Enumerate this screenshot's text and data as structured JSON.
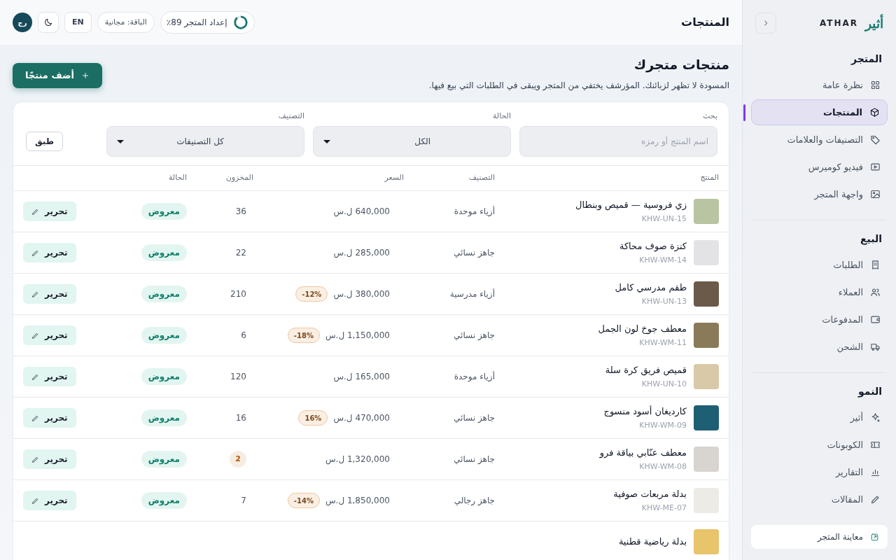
{
  "sidebar": {
    "brand": {
      "logo": "أثير",
      "name": "ATHAR"
    },
    "sections": [
      {
        "title": "المتجر",
        "items": [
          {
            "label": "نظرة عامة",
            "selected": false
          },
          {
            "label": "المنتجات",
            "selected": true
          },
          {
            "label": "التصنيفات والعلامات",
            "selected": false
          },
          {
            "label": "فيديو كوميرس",
            "selected": false
          },
          {
            "label": "واجهة المتجر",
            "selected": false
          }
        ]
      },
      {
        "title": "البيع",
        "items": [
          {
            "label": "الطلبات",
            "selected": false
          },
          {
            "label": "العملاء",
            "selected": false
          },
          {
            "label": "المدفوعات",
            "selected": false
          },
          {
            "label": "الشحن",
            "selected": false
          }
        ]
      },
      {
        "title": "النمو",
        "items": [
          {
            "label": "أثير",
            "selected": false
          },
          {
            "label": "الكوبونات",
            "selected": false
          },
          {
            "label": "التقارير",
            "selected": false
          },
          {
            "label": "المقالات",
            "selected": false
          }
        ]
      }
    ],
    "preview_link": "معاينة المتجر"
  },
  "header": {
    "title": "المنتجات",
    "setup": {
      "label": "إعداد المتجر 89٪",
      "level": 0.89
    },
    "plan": "الباقة: مجانية",
    "language": "EN",
    "avatar": "رج"
  },
  "page": {
    "title": "منتجات متجرك",
    "subtitle": "المسودة لا تظهر لزبائنك. المؤرشف يختفي من المتجر ويبقى في الطلبات التي بيع فيها.",
    "add_button": "أضف منتجًا"
  },
  "filters": {
    "search": {
      "label": "بحث",
      "placeholder": "اسم المنتج أو رمزه"
    },
    "status": {
      "label": "الحالة",
      "value": "الكل"
    },
    "category": {
      "label": "التصنيف",
      "value": "كل التصنيفات"
    },
    "apply": "طبق"
  },
  "table": {
    "columns": [
      "المنتج",
      "التصنيف",
      "السعر",
      "المخزون",
      "الحالة"
    ],
    "rows": [
      {
        "name": "زي فروسية — قميص وبنطال",
        "sku": "KHW-UN-15",
        "category": "أزياء موحدة",
        "price": "640,000 ل.س",
        "stock": "36",
        "low_stock": false,
        "status": "معروض",
        "action": "تحرير"
      },
      {
        "name": "كنزة صوف محاكة",
        "sku": "KHW-WM-14",
        "category": "جاهز نسائي",
        "price": "285,000 ل.س",
        "stock": "22",
        "low_stock": false,
        "status": "معروض",
        "action": "تحرير"
      },
      {
        "name": "طقم مدرسي كامل",
        "sku": "KHW-UN-13",
        "category": "أزياء مدرسية",
        "price": "380,000 ل.س",
        "discount": "-12%",
        "stock": "210",
        "low_stock": false,
        "status": "معروض",
        "action": "تحرير"
      },
      {
        "name": "معطف جوخ لون الجمل",
        "sku": "KHW-WM-11",
        "category": "جاهز نسائي",
        "price": "1,150,000 ل.س",
        "discount": "-18%",
        "stock": "6",
        "low_stock": false,
        "status": "معروض",
        "action": "تحرير"
      },
      {
        "name": "قميص فريق كرة سلة",
        "sku": "KHW-UN-10",
        "category": "أزياء موحدة",
        "price": "165,000 ل.س",
        "stock": "120",
        "low_stock": false,
        "status": "معروض",
        "action": "تحرير"
      },
      {
        "name": "كارديغان أسود منسوج",
        "sku": "KHW-WM-09",
        "category": "جاهز نسائي",
        "price": "470,000 ل.س",
        "discount": "16%",
        "stock": "16",
        "low_stock": false,
        "status": "معروض",
        "action": "تحرير"
      },
      {
        "name": "معطف عنّابي بياقة فرو",
        "sku": "KHW-WM-08",
        "category": "جاهز نسائي",
        "price": "1,320,000 ل.س",
        "stock": "2",
        "low_stock": true,
        "status": "معروض",
        "action": "تحرير"
      },
      {
        "name": "بدلة مربعات صوفية",
        "sku": "KHW-ME-07",
        "category": "جاهز رجالي",
        "price": "1,850,000 ل.س",
        "discount": "-14%",
        "stock": "7",
        "low_stock": false,
        "status": "معروض",
        "action": "تحرير"
      },
      {
        "name": "بدلة رياضية قطنية"
      }
    ]
  }
}
